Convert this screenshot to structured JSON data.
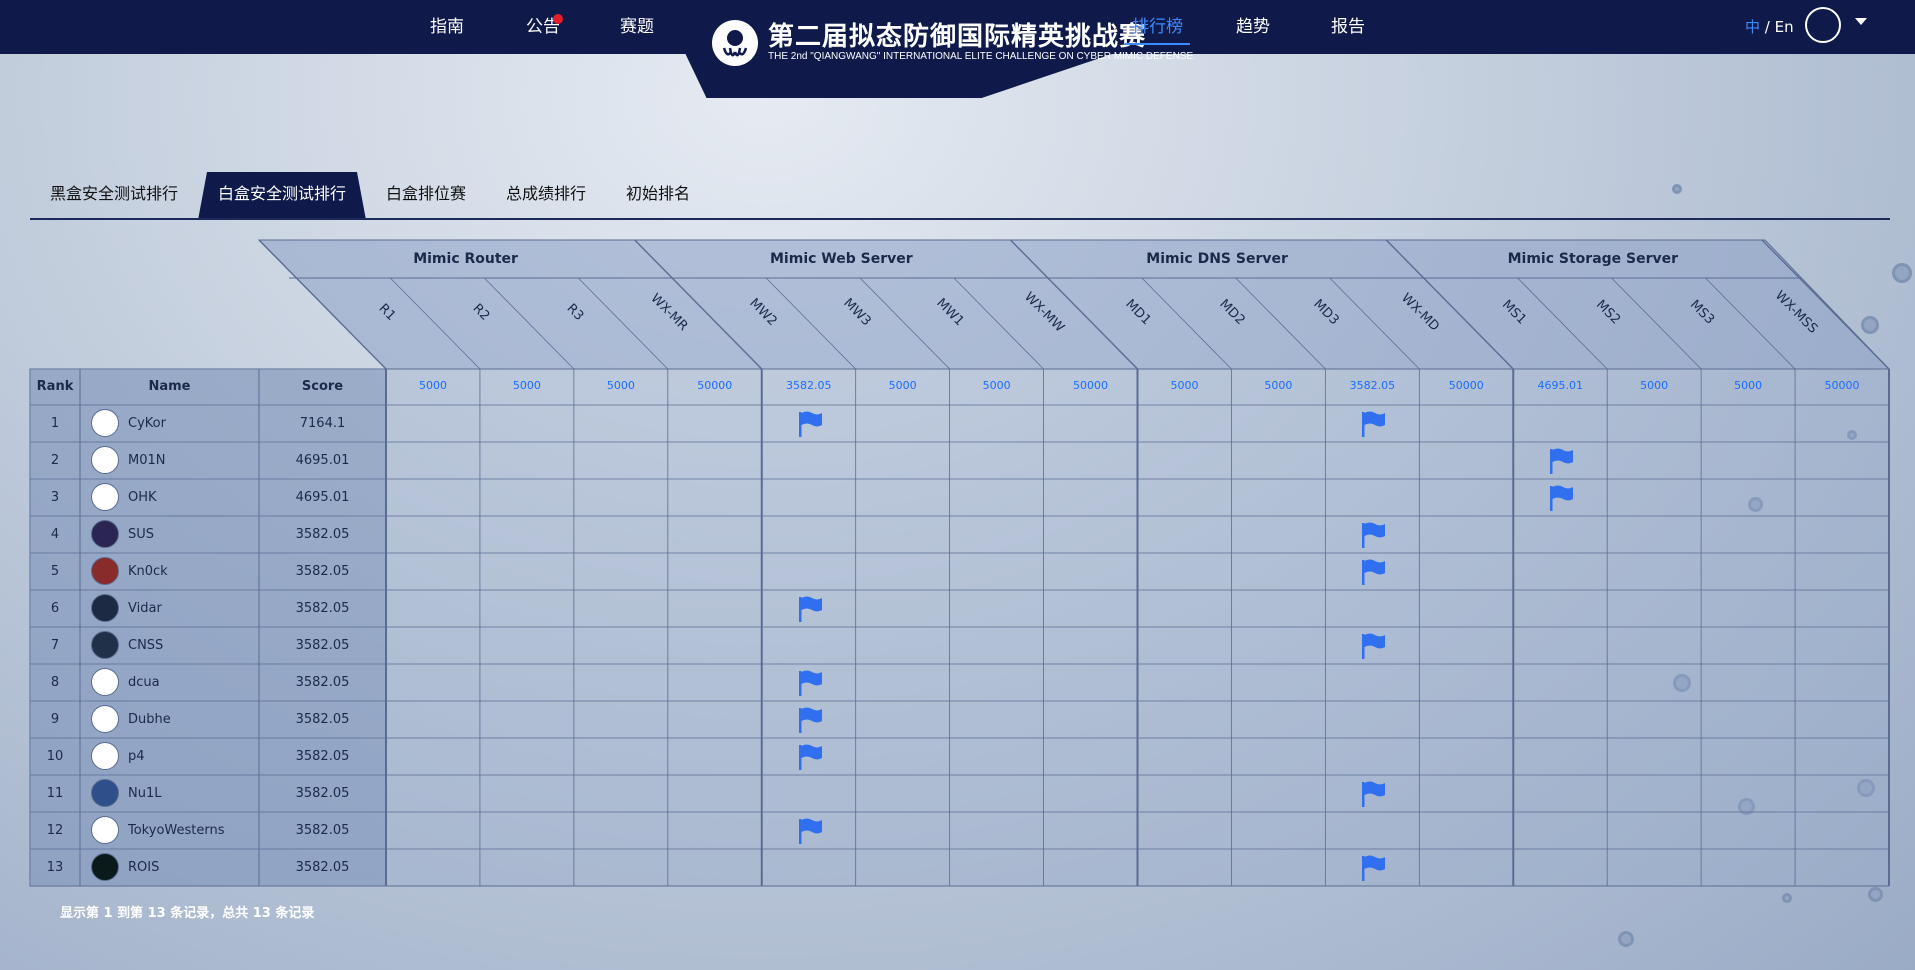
{
  "nav": {
    "items": [
      "指南",
      "公告",
      "赛题",
      "排行榜",
      "趋势",
      "报告"
    ],
    "active": "排行榜",
    "logo_title": "第二届拟态防御国际精英挑战赛",
    "logo_subtitle": "THE 2nd \"QIANGWANG\" INTERNATIONAL ELITE CHALLENGE ON CYBER MIMIC DEFENSE",
    "lang_zh": "中",
    "lang_sep": " / ",
    "lang_en": "En"
  },
  "tabs": [
    "黑盒安全测试排行",
    "白盒安全测试排行",
    "白盒排位赛",
    "总成绩排行",
    "初始排名"
  ],
  "active_tab": "白盒安全测试排行",
  "table": {
    "col_rank": "Rank",
    "col_name": "Name",
    "col_score": "Score",
    "groups": [
      {
        "name": "Mimic Router",
        "challenges": [
          "R1",
          "R2",
          "R3",
          "WX-MR"
        ],
        "points": [
          "5000",
          "5000",
          "5000",
          "50000"
        ]
      },
      {
        "name": "Mimic Web Server",
        "challenges": [
          "MW2",
          "MW3",
          "MW1",
          "WX-MW"
        ],
        "points": [
          "3582.05",
          "5000",
          "5000",
          "50000"
        ]
      },
      {
        "name": "Mimic DNS Server",
        "challenges": [
          "MD1",
          "MD2",
          "MD3",
          "WX-MD"
        ],
        "points": [
          "5000",
          "5000",
          "3582.05",
          "50000"
        ]
      },
      {
        "name": "Mimic Storage Server",
        "challenges": [
          "MS1",
          "MS2",
          "MS3",
          "WX-MSS"
        ],
        "points": [
          "4695.01",
          "5000",
          "5000",
          "50000"
        ]
      }
    ],
    "rows": [
      {
        "rank": "1",
        "name": "CyKor",
        "score": "7164.1",
        "solved": [
          4,
          10
        ]
      },
      {
        "rank": "2",
        "name": "M01N",
        "score": "4695.01",
        "solved": [
          12
        ]
      },
      {
        "rank": "3",
        "name": "OHK",
        "score": "4695.01",
        "solved": [
          12
        ]
      },
      {
        "rank": "4",
        "name": "SUS",
        "score": "3582.05",
        "solved": [
          10
        ]
      },
      {
        "rank": "5",
        "name": "Kn0ck",
        "score": "3582.05",
        "solved": [
          10
        ]
      },
      {
        "rank": "6",
        "name": "Vidar",
        "score": "3582.05",
        "solved": [
          4
        ]
      },
      {
        "rank": "7",
        "name": "CNSS",
        "score": "3582.05",
        "solved": [
          10
        ]
      },
      {
        "rank": "8",
        "name": "dcua",
        "score": "3582.05",
        "solved": [
          4
        ]
      },
      {
        "rank": "9",
        "name": "Dubhe",
        "score": "3582.05",
        "solved": [
          4
        ]
      },
      {
        "rank": "10",
        "name": "p4",
        "score": "3582.05",
        "solved": [
          4
        ]
      },
      {
        "rank": "11",
        "name": "Nu1L",
        "score": "3582.05",
        "solved": [
          10
        ]
      },
      {
        "rank": "12",
        "name": "TokyoWesterns",
        "score": "3582.05",
        "solved": [
          4
        ]
      },
      {
        "rank": "13",
        "name": "ROIS",
        "score": "3582.05",
        "solved": [
          10
        ]
      }
    ]
  },
  "footer_note": "显示第 1 到第 13 条记录，总共 13 条记录",
  "colors": {
    "nav_bg": "#0f1a4a",
    "accent": "#3c8cff",
    "flag": "#2f6ff0",
    "points": "#1a6dff"
  }
}
